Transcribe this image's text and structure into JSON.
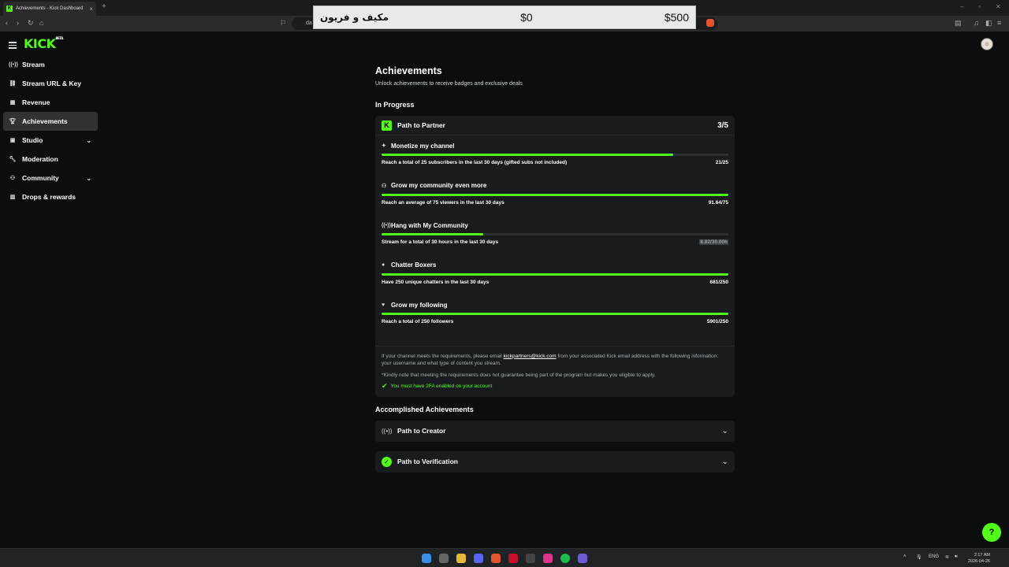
{
  "browser": {
    "tab_title": "Achievements - Kick Dashboard",
    "tab_close": "×",
    "new_tab": "+",
    "url_text": "da"
  },
  "overlay": {
    "left_text": "مكيف و فريون",
    "middle_text": "$0",
    "right_text": "$500"
  },
  "header": {
    "logo": "KICK",
    "logo_badge": "BETA"
  },
  "sidebar": {
    "items": [
      {
        "label": "Stream",
        "icon": "broadcast-icon"
      },
      {
        "label": "Stream URL & Key",
        "icon": "link-icon"
      },
      {
        "label": "Revenue",
        "icon": "revenue-icon"
      },
      {
        "label": "Achievements",
        "icon": "trophy-icon",
        "active": true
      },
      {
        "label": "Studio",
        "icon": "studio-icon",
        "expandable": true
      },
      {
        "label": "Moderation",
        "icon": "wrench-icon"
      },
      {
        "label": "Community",
        "icon": "community-icon",
        "expandable": true
      },
      {
        "label": "Drops & rewards",
        "icon": "gift-icon"
      }
    ]
  },
  "main": {
    "title": "Achievements",
    "subtitle": "Unlock achievements to receive badges and exclusive deals",
    "in_progress_heading": "In Progress",
    "partner_card": {
      "title": "Path to Partner",
      "count": "3/5",
      "goals": [
        {
          "title": "Monetize my channel",
          "icon": "sparkle-icon",
          "desc": "Reach a total of 25 subscribers in the last 30 days (gifted subs not included)",
          "progress": "21/25",
          "fraction": 0.84
        },
        {
          "title": "Grow my community even more",
          "icon": "users-icon",
          "desc": "Reach an average of 75 viewers in the last 30 days",
          "progress": "91.64/75",
          "fraction": 1.0
        },
        {
          "title": "Hang with My Community",
          "icon": "broadcast-icon",
          "desc": "Stream for a total of 30 hours in the last 30 days",
          "progress": "8.82/30.00h",
          "fraction": 0.294,
          "dim": true
        },
        {
          "title": "Chatter Boxers",
          "icon": "chat-icon",
          "desc": "Have 250 unique chatters in the last 30 days",
          "progress": "681/250",
          "fraction": 1.0
        },
        {
          "title": "Grow my following",
          "icon": "heart-icon",
          "desc": "Reach a total of 250 followers",
          "progress": "5901/250",
          "fraction": 1.0
        }
      ],
      "note_before_email": "If your channel meets the requirements, please email ",
      "email": "kickpartners@kick.com",
      "note_after_email": " from your associated Kick email address with the following information: your username and what type of content you stream.",
      "disclaimer": "*Kindly note that meeting the requirements does not guarantee being part of the program but makes you eligible to apply.",
      "twofa": "You must have 2FA enabled on your account"
    },
    "accomplished_heading": "Accomplished Achievements",
    "accomplished": [
      {
        "title": "Path to Creator",
        "icon": "broadcast-icon"
      },
      {
        "title": "Path to Verification",
        "icon": "verified-badge-icon"
      }
    ]
  },
  "taskbar": {
    "lang": "ENG",
    "time": "2:17 AM",
    "date": "2026-04-26"
  },
  "colors": {
    "accent": "#53fc18",
    "background": "#0b0e0f",
    "card": "#191c1e"
  }
}
